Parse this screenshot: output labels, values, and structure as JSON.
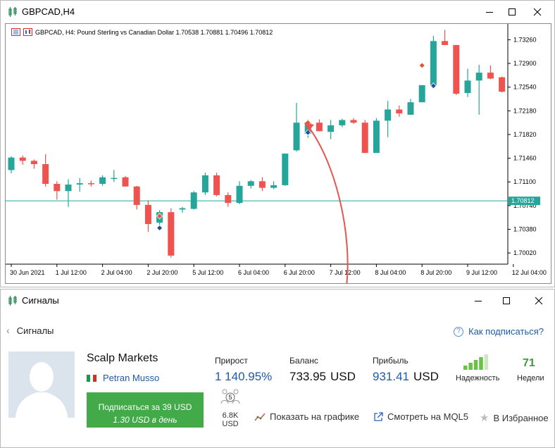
{
  "chart_window": {
    "title": "GBPCAD,H4",
    "header_text": "GBPCAD, H4:  Pound Sterling vs Canadian Dollar  1.70538 1.70881 1.70496 1.70812",
    "current_price": "1.70812",
    "colors": {
      "bull": "#26a69a",
      "bear": "#ef5350",
      "price_line": "#26a69a",
      "arrow": "#e85550"
    }
  },
  "chart_data": {
    "type": "candlestick",
    "symbol": "GBPCAD",
    "timeframe": "H4",
    "ylim": [
      1.6985,
      1.735
    ],
    "y_ticks": [
      "1.73260",
      "1.72900",
      "1.72540",
      "1.72180",
      "1.71820",
      "1.71460",
      "1.71100",
      "1.70740",
      "1.70380",
      "1.70020"
    ],
    "y_tick_values": [
      1.7326,
      1.729,
      1.7254,
      1.7218,
      1.7182,
      1.7146,
      1.711,
      1.7074,
      1.7038,
      1.7002
    ],
    "x_ticks": [
      {
        "label": "30 Jun 2021",
        "index": 0
      },
      {
        "label": "1 Jul 12:00",
        "index": 4
      },
      {
        "label": "2 Jul 04:00",
        "index": 8
      },
      {
        "label": "2 Jul 20:00",
        "index": 12
      },
      {
        "label": "5 Jul 12:00",
        "index": 16
      },
      {
        "label": "6 Jul 04:00",
        "index": 20
      },
      {
        "label": "6 Jul 20:00",
        "index": 24
      },
      {
        "label": "7 Jul 12:00",
        "index": 28
      },
      {
        "label": "8 Jul 04:00",
        "index": 32
      },
      {
        "label": "8 Jul 20:00",
        "index": 36
      },
      {
        "label": "9 Jul 12:00",
        "index": 40
      },
      {
        "label": "12 Jul 04:00",
        "index": 44
      }
    ],
    "candles": [
      {
        "o": 1.7128,
        "h": 1.7149,
        "l": 1.7123,
        "c": 1.7147
      },
      {
        "o": 1.7147,
        "h": 1.715,
        "l": 1.7136,
        "c": 1.7142
      },
      {
        "o": 1.7142,
        "h": 1.7144,
        "l": 1.713,
        "c": 1.7137
      },
      {
        "o": 1.7137,
        "h": 1.7152,
        "l": 1.7103,
        "c": 1.7107
      },
      {
        "o": 1.7107,
        "h": 1.7111,
        "l": 1.7083,
        "c": 1.7096
      },
      {
        "o": 1.7096,
        "h": 1.7114,
        "l": 1.7072,
        "c": 1.7106
      },
      {
        "o": 1.7106,
        "h": 1.7116,
        "l": 1.7095,
        "c": 1.7108
      },
      {
        "o": 1.7108,
        "h": 1.7112,
        "l": 1.7103,
        "c": 1.7107
      },
      {
        "o": 1.7107,
        "h": 1.712,
        "l": 1.7104,
        "c": 1.7117
      },
      {
        "o": 1.7116,
        "h": 1.7128,
        "l": 1.711,
        "c": 1.7116
      },
      {
        "o": 1.7117,
        "h": 1.7119,
        "l": 1.7103,
        "c": 1.7103
      },
      {
        "o": 1.7103,
        "h": 1.7104,
        "l": 1.7068,
        "c": 1.7075
      },
      {
        "o": 1.7075,
        "h": 1.7082,
        "l": 1.7034,
        "c": 1.7046
      },
      {
        "o": 1.7048,
        "h": 1.7067,
        "l": 1.7036,
        "c": 1.7064
      },
      {
        "o": 1.7064,
        "h": 1.707,
        "l": 1.6995,
        "c": 1.6998
      },
      {
        "o": 1.7068,
        "h": 1.7072,
        "l": 1.7063,
        "c": 1.707
      },
      {
        "o": 1.7069,
        "h": 1.7096,
        "l": 1.7068,
        "c": 1.7094
      },
      {
        "o": 1.7094,
        "h": 1.7124,
        "l": 1.709,
        "c": 1.712
      },
      {
        "o": 1.712,
        "h": 1.7124,
        "l": 1.7088,
        "c": 1.709
      },
      {
        "o": 1.709,
        "h": 1.7094,
        "l": 1.7072,
        "c": 1.7078
      },
      {
        "o": 1.7078,
        "h": 1.7111,
        "l": 1.7076,
        "c": 1.7104
      },
      {
        "o": 1.7104,
        "h": 1.7113,
        "l": 1.71,
        "c": 1.7111
      },
      {
        "o": 1.7111,
        "h": 1.7117,
        "l": 1.7096,
        "c": 1.7101
      },
      {
        "o": 1.7101,
        "h": 1.7111,
        "l": 1.7099,
        "c": 1.7105
      },
      {
        "o": 1.7105,
        "h": 1.7153,
        "l": 1.7104,
        "c": 1.7153
      },
      {
        "o": 1.7158,
        "h": 1.723,
        "l": 1.7156,
        "c": 1.72
      },
      {
        "o": 1.7183,
        "h": 1.7205,
        "l": 1.7177,
        "c": 1.72
      },
      {
        "o": 1.72,
        "h": 1.7205,
        "l": 1.7187,
        "c": 1.7187
      },
      {
        "o": 1.7186,
        "h": 1.7204,
        "l": 1.7175,
        "c": 1.7196
      },
      {
        "o": 1.7196,
        "h": 1.7206,
        "l": 1.7193,
        "c": 1.7204
      },
      {
        "o": 1.7204,
        "h": 1.7207,
        "l": 1.7198,
        "c": 1.72
      },
      {
        "o": 1.72,
        "h": 1.7204,
        "l": 1.7154,
        "c": 1.7154
      },
      {
        "o": 1.7154,
        "h": 1.7207,
        "l": 1.7154,
        "c": 1.7203
      },
      {
        "o": 1.7203,
        "h": 1.7233,
        "l": 1.7178,
        "c": 1.722
      },
      {
        "o": 1.722,
        "h": 1.7226,
        "l": 1.7209,
        "c": 1.7214
      },
      {
        "o": 1.7212,
        "h": 1.7236,
        "l": 1.7212,
        "c": 1.7231
      },
      {
        "o": 1.7231,
        "h": 1.7257,
        "l": 1.7231,
        "c": 1.7257
      },
      {
        "o": 1.7257,
        "h": 1.7332,
        "l": 1.7253,
        "c": 1.7324
      },
      {
        "o": 1.7324,
        "h": 1.7341,
        "l": 1.7318,
        "c": 1.7318
      },
      {
        "o": 1.7318,
        "h": 1.7318,
        "l": 1.7242,
        "c": 1.7244
      },
      {
        "o": 1.7245,
        "h": 1.7282,
        "l": 1.7239,
        "c": 1.7264
      },
      {
        "o": 1.7264,
        "h": 1.7288,
        "l": 1.7212,
        "c": 1.7276
      },
      {
        "o": 1.7276,
        "h": 1.7287,
        "l": 1.7266,
        "c": 1.7267
      },
      {
        "o": 1.7269,
        "h": 1.727,
        "l": 1.7246,
        "c": 1.7247
      },
      {
        "o": 1.7248,
        "h": 1.7288,
        "l": 1.7244,
        "c": 1.7279
      },
      {
        "o": 1.7279,
        "h": 1.729,
        "l": 1.7276,
        "c": 1.7288
      },
      {
        "o": 1.7289,
        "h": 1.7312,
        "l": 1.7282,
        "c": 1.7306
      },
      {
        "o": 1.7306,
        "h": 1.7318,
        "l": 1.7255,
        "c": 1.7261
      },
      {
        "o": 1.7262,
        "h": 1.7336,
        "l": 1.7257,
        "c": 1.7306
      },
      {
        "o": 1.7306,
        "h": 1.7311,
        "l": 1.7302,
        "c": 1.7306
      }
    ],
    "price_line": 1.70812,
    "trade_markers": [
      {
        "index": 13,
        "price": 1.7058,
        "kind": "sell"
      },
      {
        "index": 13,
        "price": 1.704,
        "kind": "buy"
      },
      {
        "index": 26,
        "price": 1.72,
        "kind": "sell"
      },
      {
        "index": 26,
        "price": 1.7185,
        "kind": "buy"
      },
      {
        "index": 36,
        "price": 1.7287,
        "kind": "sell"
      },
      {
        "index": 37,
        "price": 1.7256,
        "kind": "buy"
      }
    ]
  },
  "signals_window": {
    "title": "Сигналы",
    "back_label": "Сигналы",
    "how_to_subscribe": "Как подписаться?",
    "signal_name": "Scalp Markets",
    "author": "Petran Musso",
    "subscribe_line1": "Подписаться за 39 USD",
    "subscribe_line2": "1.30 USD в день",
    "subscribers_count": "5",
    "subscribers_volume": "6.8K USD",
    "stats": {
      "growth_label": "Прирост",
      "growth_value": "1 140.95%",
      "balance_label": "Баланс",
      "balance_value": "733.95",
      "balance_currency": "USD",
      "profit_label": "Прибыль",
      "profit_value": "931.41",
      "profit_currency": "USD",
      "reliability_label": "Надежность",
      "weeks_label": "Недели",
      "weeks_value": "71"
    },
    "actions": {
      "show_on_chart": "Показать на графике",
      "view_on_mql5": "Смотреть на MQL5",
      "favorites": "В Избранное"
    },
    "reliability_level": 0.8,
    "colors": {
      "accent_blue": "#1e5aa8",
      "green": "#43aa4a"
    }
  }
}
